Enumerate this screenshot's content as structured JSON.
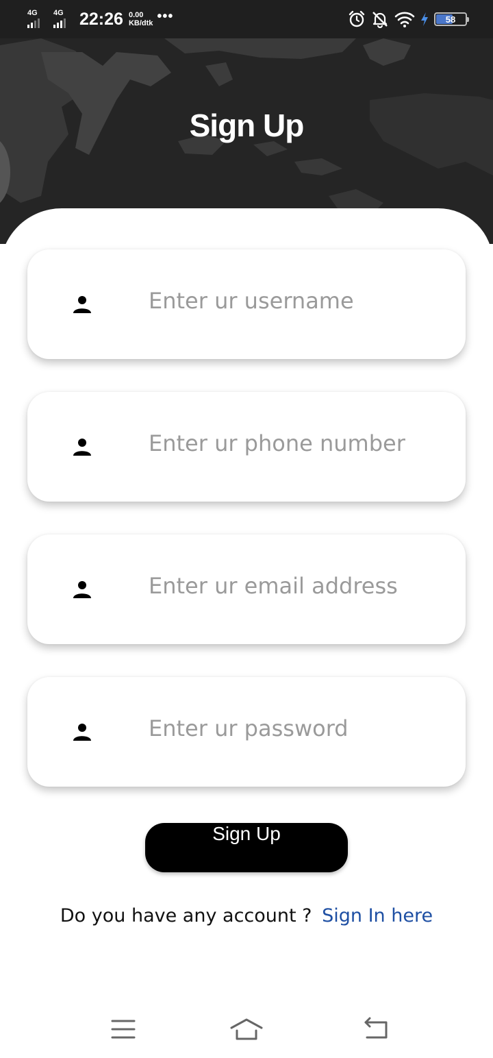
{
  "status_bar": {
    "network_1": "4G",
    "network_2": "4G",
    "time": "22:26",
    "speed_value": "0.00",
    "speed_unit": "KB/dtk",
    "more": "•••",
    "battery": "58"
  },
  "header": {
    "title": "Sign Up"
  },
  "form": {
    "fields": [
      {
        "placeholder": "Enter ur username",
        "icon": "person-icon"
      },
      {
        "placeholder": "Enter ur phone number",
        "icon": "person-icon"
      },
      {
        "placeholder": "Enter ur email address",
        "icon": "person-icon"
      },
      {
        "placeholder": "Enter ur password",
        "icon": "person-icon"
      }
    ],
    "submit_label": "Sign Up"
  },
  "footer": {
    "question": "Do you have any account ?",
    "link": "Sign In here"
  },
  "nav_bar": {
    "icons": [
      "menu-icon",
      "home-icon",
      "back-icon"
    ]
  },
  "colors": {
    "header_bg": "#252525",
    "button_bg": "#000000",
    "link": "#1e4fa3",
    "placeholder": "#9a9a9a"
  }
}
